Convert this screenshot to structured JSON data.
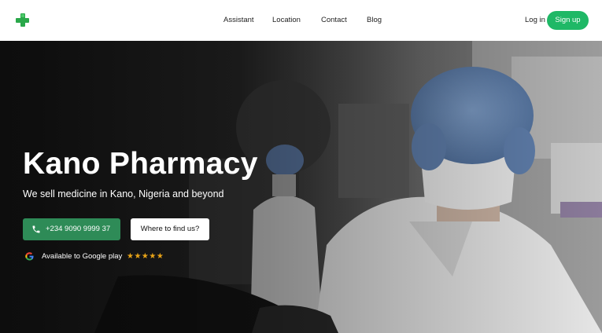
{
  "nav": {
    "links": [
      "Assistant",
      "Location",
      "Contact",
      "Blog"
    ],
    "login_label": "Log in",
    "signup_label": "Sign up"
  },
  "hero": {
    "title": "Kano Pharmacy",
    "subtitle": "We sell medicine in Kano, Nigeria and beyond",
    "phone_label": "+234 9090 9999 37",
    "find_label": "Where to find us?",
    "google_play_label": "Available to Google play",
    "stars": "★★★★★",
    "rating": 5
  },
  "colors": {
    "brand_green": "#2aa84a",
    "signup_green": "#1fb866",
    "phone_button_green": "#2e8b57",
    "star_gold": "#e8a317"
  },
  "icons": [
    "medical-cross-logo-icon",
    "phone-icon",
    "google-icon"
  ]
}
